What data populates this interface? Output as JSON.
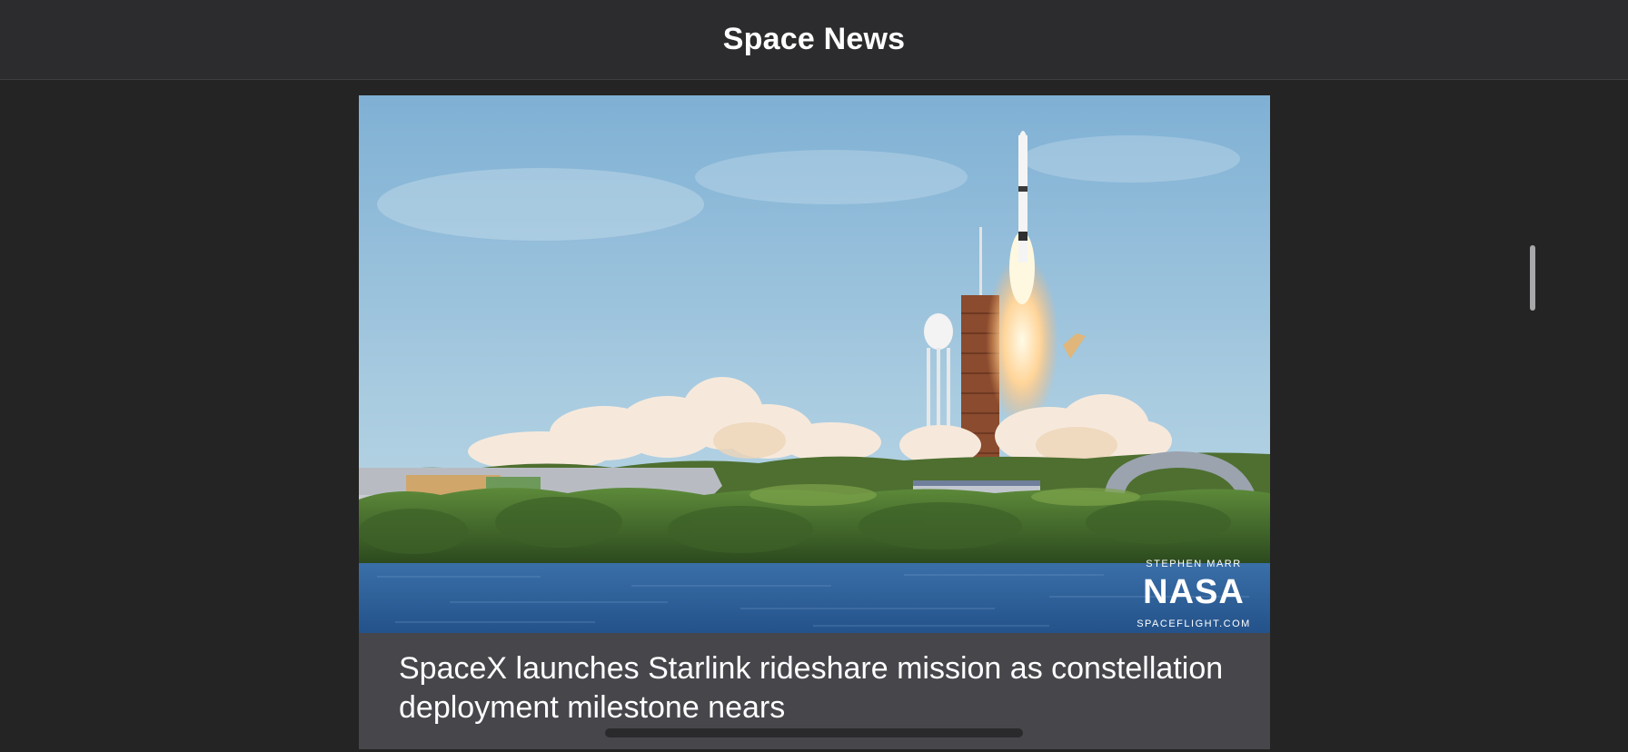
{
  "nav": {
    "title": "Space News"
  },
  "article": {
    "title": "SpaceX launches Starlink rideshare mission as constellation deployment milestone nears",
    "image": {
      "subject": "rocket-launch-photo",
      "watermark": {
        "photographer": "STEPHEN MARR",
        "logo": "NASA",
        "site": "SPACEFLIGHT.COM"
      }
    }
  },
  "colors": {
    "background": "#242424",
    "nav_background": "#2c2c2e",
    "card_background": "#47464b",
    "text": "#ffffff",
    "scroll_indicator": "#a8a8aa"
  }
}
